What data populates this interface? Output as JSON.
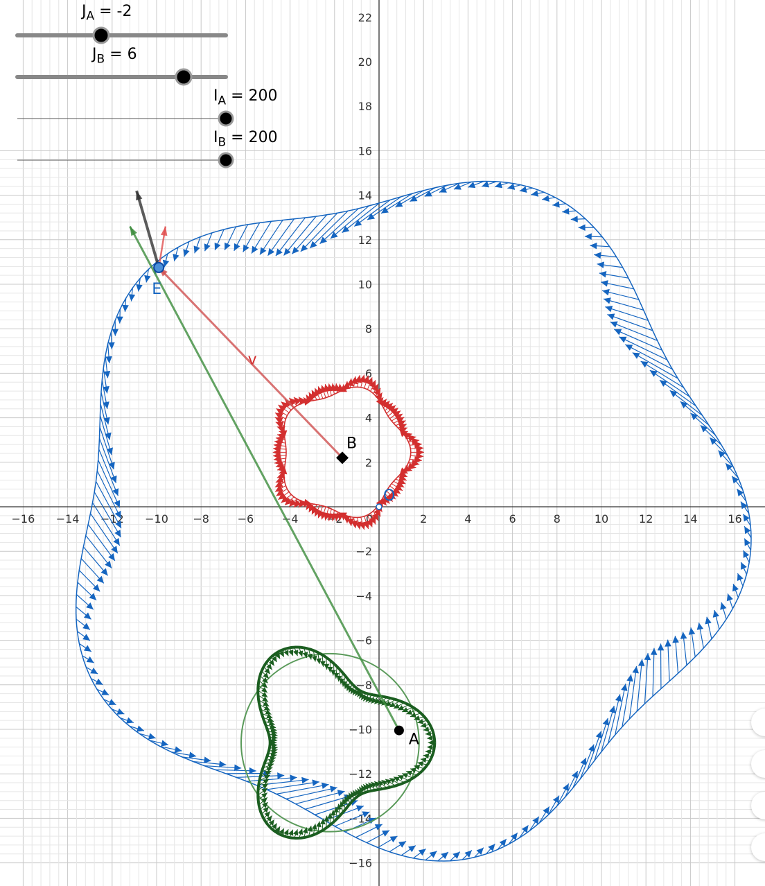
{
  "sliders": [
    {
      "var": "J",
      "sub": "A",
      "eq": " = -2",
      "value": -2
    },
    {
      "var": "J",
      "sub": "B",
      "eq": " = 6",
      "value": 6
    },
    {
      "var": "I",
      "sub": "A",
      "eq": " = 200",
      "value": 200
    },
    {
      "var": "I",
      "sub": "B",
      "eq": " = 200",
      "value": 200
    }
  ],
  "axes": {
    "x_ticks": [
      -16,
      -14,
      -12,
      -10,
      -8,
      -6,
      -4,
      -2,
      0,
      2,
      4,
      6,
      8,
      10,
      12,
      14,
      16
    ],
    "y_ticks": [
      -16,
      -14,
      -12,
      -10,
      -8,
      -6,
      -4,
      -2,
      2,
      4,
      6,
      8,
      10,
      12,
      14,
      16,
      18,
      20,
      22
    ],
    "x_labels": [
      "−16",
      "−14",
      "−12",
      "−10",
      "−8",
      "−6",
      "−4",
      "−2",
      "0",
      "2",
      "4",
      "6",
      "8",
      "10",
      "12",
      "14",
      "16"
    ],
    "y_labels": [
      "−16",
      "−14",
      "−12",
      "−10",
      "−8",
      "−6",
      "−4",
      "−2",
      "2",
      "4",
      "6",
      "8",
      "10",
      "12",
      "14",
      "16",
      "18",
      "20",
      "22"
    ]
  },
  "points": {
    "A": {
      "label": "A",
      "x": 0.9,
      "y": -10.05
    },
    "B": {
      "label": "B",
      "x": -1.65,
      "y": 2.2
    },
    "O": {
      "label": "O",
      "x": 0,
      "y": 0
    },
    "E": {
      "label": "E",
      "x": -9.9,
      "y": 10.75
    }
  },
  "vector_label": "v",
  "colors": {
    "blue": "#1565c0",
    "red": "#d32f2f",
    "green": "#1b5e20",
    "green_light": "#5a9a5a",
    "grid_minor": "#e6e6e6",
    "grid_major": "#c8c8c8"
  }
}
